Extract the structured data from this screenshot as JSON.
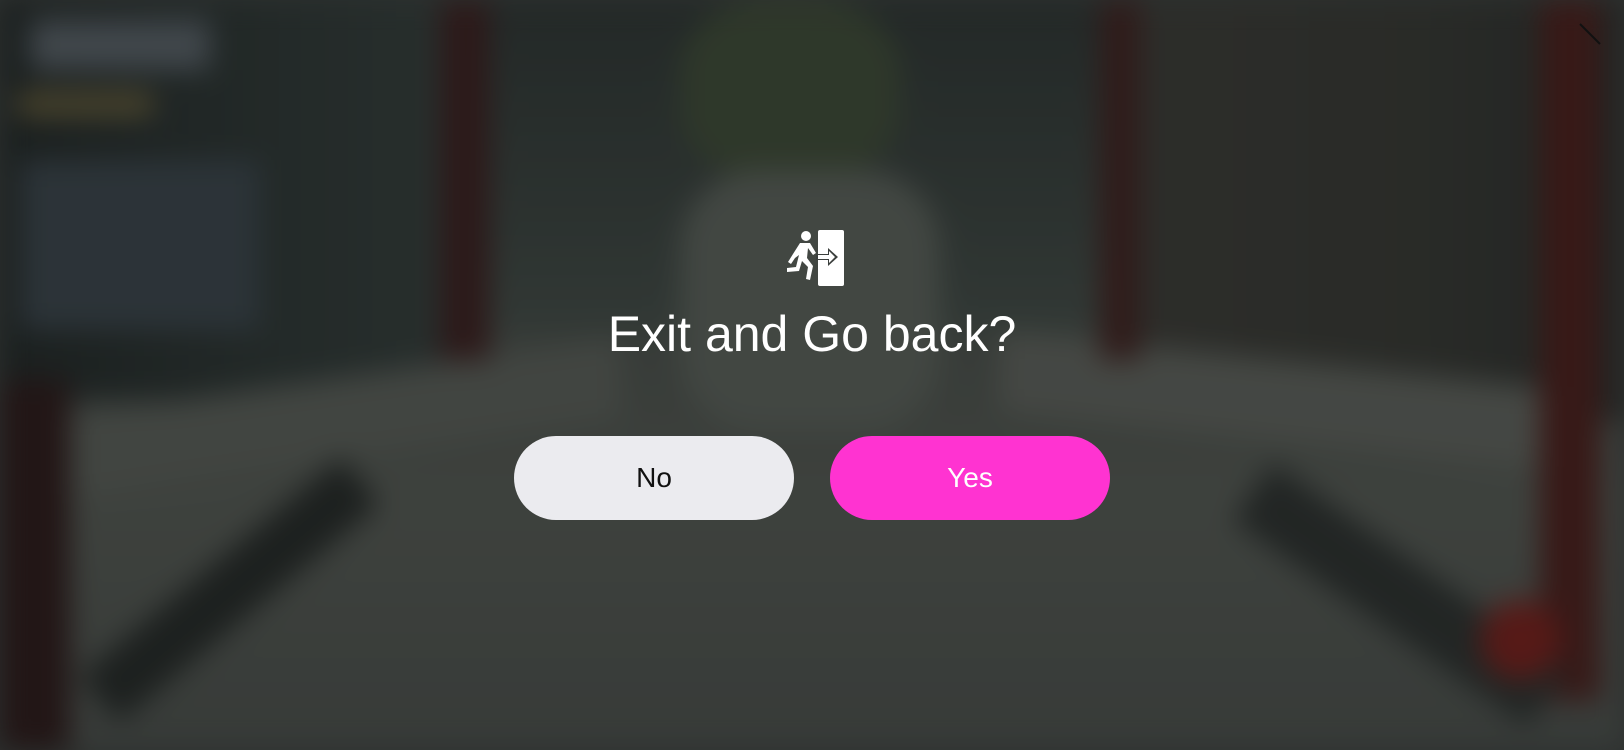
{
  "dialog": {
    "icon": "exit-running-person-icon",
    "title": "Exit and Go back?",
    "no_label": "No",
    "yes_label": "Yes"
  },
  "top_bar": {
    "close_icon": "close-icon"
  },
  "colors": {
    "no_button_bg": "#ebebef",
    "yes_button_bg": "#ff33d1",
    "title_text": "#ffffff"
  }
}
